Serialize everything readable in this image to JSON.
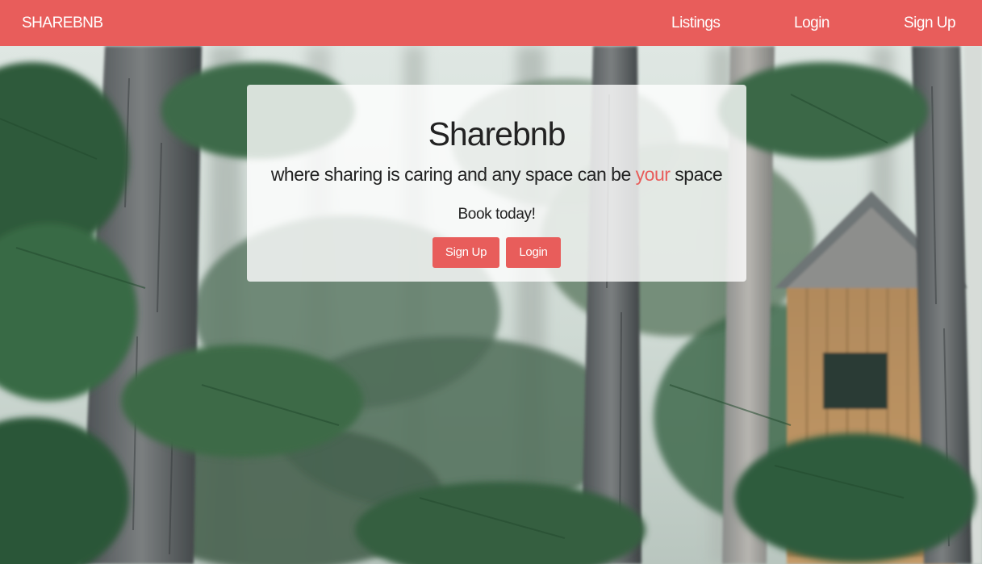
{
  "navbar": {
    "brand": "SHAREBNB",
    "links": {
      "listings": "Listings",
      "login": "Login",
      "signup": "Sign Up"
    }
  },
  "hero": {
    "title": "Sharebnb",
    "subtitle_before": "where sharing is caring and any space can be ",
    "subtitle_accent": "your",
    "subtitle_after": " space",
    "cta_text": "Book today!",
    "signup_button": "Sign Up",
    "login_button": "Login"
  },
  "colors": {
    "brand": "#e85d5b",
    "card_background": "rgba(255,255,255,0.80)",
    "text": "#222222"
  },
  "background_image": "forest with pine trees and a wooden cabin"
}
